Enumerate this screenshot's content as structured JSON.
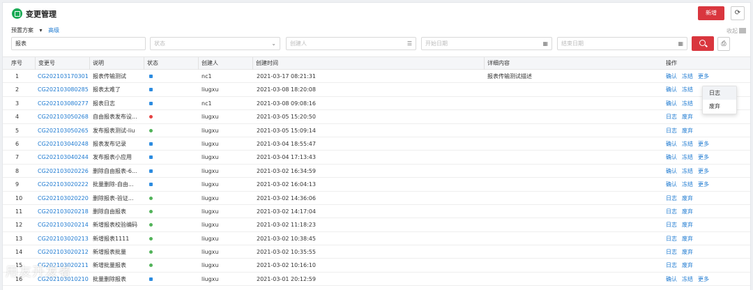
{
  "header": {
    "title": "变更管理",
    "new_label": "新增",
    "refresh_icon": "refresh-icon"
  },
  "plan": {
    "label": "预置方案",
    "advanced_label": "高级",
    "collapse_label": "收起"
  },
  "filters": {
    "keyword": "报表",
    "status_placeholder": "状态",
    "creator_placeholder": "创建人",
    "start_placeholder": "开始日期",
    "end_placeholder": "结束日期"
  },
  "table": {
    "columns": [
      "序号",
      "变更号",
      "说明",
      "状态",
      "创建人",
      "创建时间",
      "详细内容",
      "操作"
    ],
    "rows": [
      {
        "no": "1",
        "code": "CG202103170301",
        "desc": "报表传输测试",
        "status": "sync",
        "creator": "nc1",
        "time": "2021-03-17 08:21:31",
        "detail": "报表传输测试描述",
        "ops": [
          "确认",
          "冻结",
          "更多"
        ]
      },
      {
        "no": "2",
        "code": "CG202103080285",
        "desc": "报表太难了",
        "status": "sync",
        "creator": "liugxu",
        "time": "2021-03-08 18:20:08",
        "detail": "",
        "ops": [
          "确认",
          "冻结"
        ]
      },
      {
        "no": "3",
        "code": "CG202103080277",
        "desc": "报表日志",
        "status": "sync",
        "creator": "nc1",
        "time": "2021-03-08 09:08:16",
        "detail": "",
        "ops": [
          "确认",
          "冻结"
        ]
      },
      {
        "no": "4",
        "code": "CG202103050268",
        "desc": "自由报表发布设...",
        "status": "err",
        "creator": "liugxu",
        "time": "2021-03-05 15:20:50",
        "detail": "",
        "ops": [
          "日志",
          "废弃"
        ]
      },
      {
        "no": "5",
        "code": "CG202103050265",
        "desc": "发布报表测试-liu",
        "status": "ok",
        "creator": "liugxu",
        "time": "2021-03-05 15:09:14",
        "detail": "",
        "ops": [
          "日志",
          "废弃"
        ]
      },
      {
        "no": "6",
        "code": "CG202103040248",
        "desc": "报表发布记录",
        "status": "sync",
        "creator": "liugxu",
        "time": "2021-03-04 18:55:47",
        "detail": "",
        "ops": [
          "确认",
          "冻结",
          "更多"
        ]
      },
      {
        "no": "7",
        "code": "CG202103040244",
        "desc": "发布报表小应用",
        "status": "sync",
        "creator": "liugxu",
        "time": "2021-03-04 17:13:43",
        "detail": "",
        "ops": [
          "确认",
          "冻结",
          "更多"
        ]
      },
      {
        "no": "8",
        "code": "CG202103020226",
        "desc": "删除自由报表-6...",
        "status": "sync",
        "creator": "liugxu",
        "time": "2021-03-02 16:34:59",
        "detail": "",
        "ops": [
          "确认",
          "冻结",
          "更多"
        ]
      },
      {
        "no": "9",
        "code": "CG202103020222",
        "desc": "批量删除-自由...",
        "status": "sync",
        "creator": "liugxu",
        "time": "2021-03-02 16:04:13",
        "detail": "",
        "ops": [
          "确认",
          "冻结",
          "更多"
        ]
      },
      {
        "no": "10",
        "code": "CG202103020220",
        "desc": "删除报表-验证...",
        "status": "ok",
        "creator": "liugxu",
        "time": "2021-03-02 14:36:06",
        "detail": "",
        "ops": [
          "日志",
          "废弃"
        ]
      },
      {
        "no": "11",
        "code": "CG202103020218",
        "desc": "删除自由报表",
        "status": "ok",
        "creator": "liugxu",
        "time": "2021-03-02 14:17:04",
        "detail": "",
        "ops": [
          "日志",
          "废弃"
        ]
      },
      {
        "no": "12",
        "code": "CG202103020214",
        "desc": "新增报表校验编码",
        "status": "ok",
        "creator": "liugxu",
        "time": "2021-03-02 11:18:23",
        "detail": "",
        "ops": [
          "日志",
          "废弃"
        ]
      },
      {
        "no": "13",
        "code": "CG202103020213",
        "desc": "新增报表1111",
        "status": "ok",
        "creator": "liugxu",
        "time": "2021-03-02 10:38:45",
        "detail": "",
        "ops": [
          "日志",
          "废弃"
        ]
      },
      {
        "no": "14",
        "code": "CG202103020212",
        "desc": "新增报表批量",
        "status": "ok",
        "creator": "liugxu",
        "time": "2021-03-02 10:35:55",
        "detail": "",
        "ops": [
          "日志",
          "废弃"
        ]
      },
      {
        "no": "15",
        "code": "CG202103020211",
        "desc": "新增批量报表",
        "status": "ok",
        "creator": "liugxu",
        "time": "2021-03-02 10:16:10",
        "detail": "",
        "ops": [
          "日志",
          "废弃"
        ]
      },
      {
        "no": "16",
        "code": "CG202103010210",
        "desc": "批量删除报表",
        "status": "sync",
        "creator": "liugxu",
        "time": "2021-03-01 20:12:59",
        "detail": "",
        "ops": [
          "确认",
          "冻结",
          "更多"
        ]
      }
    ]
  },
  "more_menu": [
    "日志",
    "废弃"
  ],
  "watermark": "用友开发者"
}
